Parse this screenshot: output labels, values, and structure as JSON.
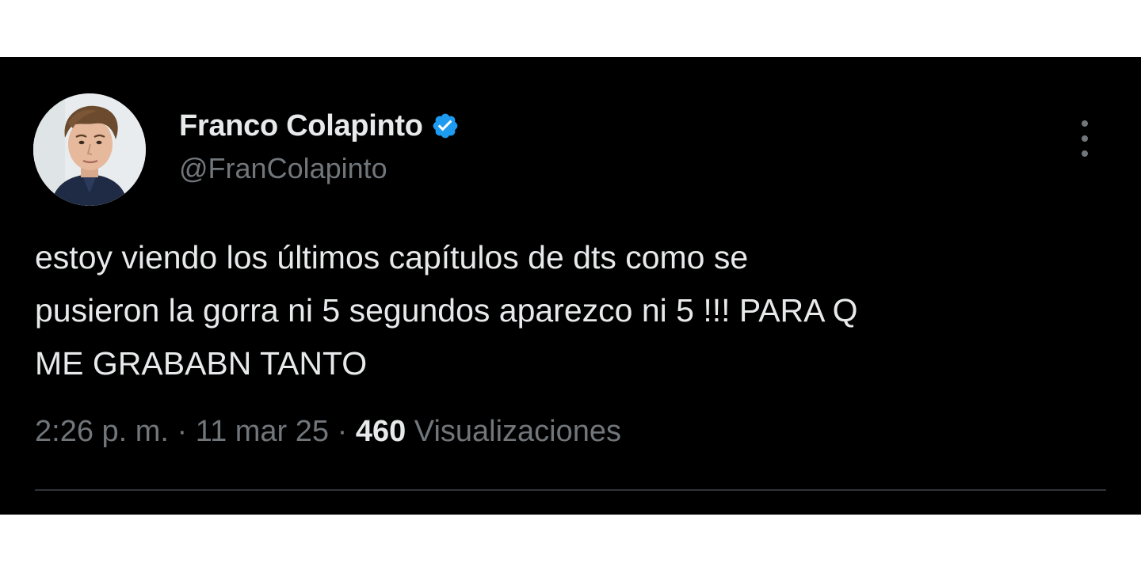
{
  "tweet": {
    "author": {
      "display_name": "Franco Colapinto",
      "handle": "@FranColapinto",
      "verified": true
    },
    "text_lines": [
      "estoy viendo los últimos capítulos de dts como se",
      "pusieron la gorra ni 5 segundos aparezco ni 5 !!! PARA Q",
      "ME GRABABN TANTO"
    ],
    "meta": {
      "time": "2:26 p. m.",
      "separator": " · ",
      "date": "11 mar 25",
      "views_count": "460",
      "views_label": " Visualizaciones"
    },
    "icons": {
      "verified": "verified-badge-icon",
      "more": "more-options-icon"
    },
    "colors": {
      "background": "#000000",
      "primary_text": "#e7e9ea",
      "secondary_text": "#71767b",
      "verified_blue": "#1d9bf0",
      "divider": "#2f3336"
    }
  }
}
